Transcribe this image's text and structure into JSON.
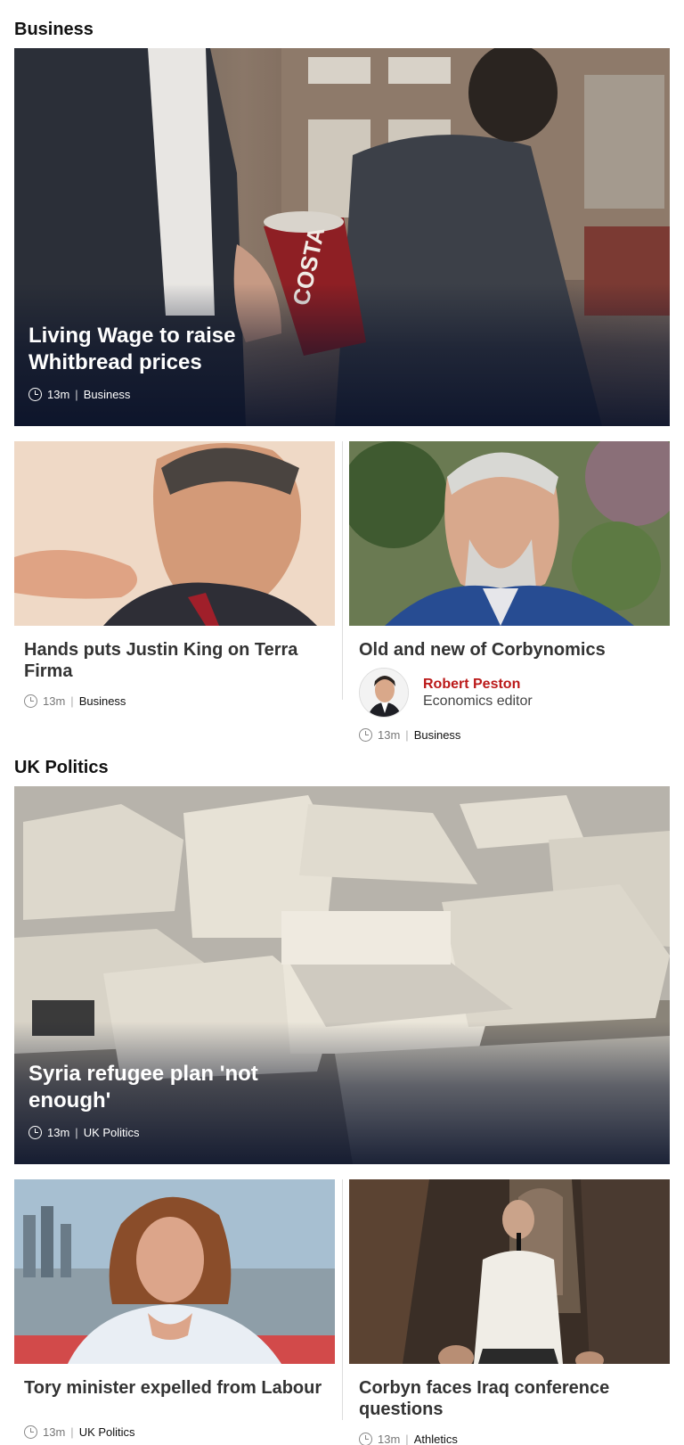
{
  "sections": [
    {
      "title": "Business",
      "hero": {
        "headline": "Living Wage to raise Whitbread prices",
        "time": "13m",
        "category": "Business",
        "cup_text": "COSTA"
      },
      "cards": [
        {
          "headline": "Hands puts Justin King on Terra Firma",
          "time": "13m",
          "category": "Business"
        },
        {
          "headline": "Old and new of Corbynomics",
          "author_name": "Robert Peston",
          "author_role": "Economics editor",
          "time": "13m",
          "category": "Business"
        }
      ]
    },
    {
      "title": "UK Politics",
      "hero": {
        "headline": "Syria refugee plan 'not enough'",
        "time": "13m",
        "category": "UK Politics"
      },
      "cards": [
        {
          "headline": "Tory minister expelled from Labour",
          "time": "13m",
          "category": "UK Politics"
        },
        {
          "headline": "Corbyn faces Iraq conference questions",
          "time": "13m",
          "category": "Athletics"
        }
      ]
    }
  ],
  "icons": {
    "time": "clock-icon"
  },
  "colors": {
    "author_name": "#bb1919",
    "hero_overlay": "#0a122a"
  }
}
